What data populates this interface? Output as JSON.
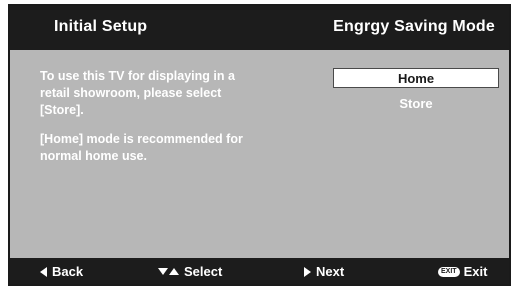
{
  "header": {
    "title_left": "Initial Setup",
    "title_right": "Engrgy Saving Mode"
  },
  "description": {
    "line1": "To use this TV for displaying in a retail showroom, please select [Store].",
    "line2": "[Home] mode is recommended for normal home use."
  },
  "options": [
    {
      "label": "Home",
      "selected": true
    },
    {
      "label": "Store",
      "selected": false
    }
  ],
  "footer": {
    "back_label": "Back",
    "select_label": "Select",
    "next_label": "Next",
    "exit_badge": "EXIT",
    "exit_label": "Exit"
  },
  "colors": {
    "bar": "#1c1c1c",
    "panel": "#b7b7b7",
    "highlight": "#ffffff"
  }
}
